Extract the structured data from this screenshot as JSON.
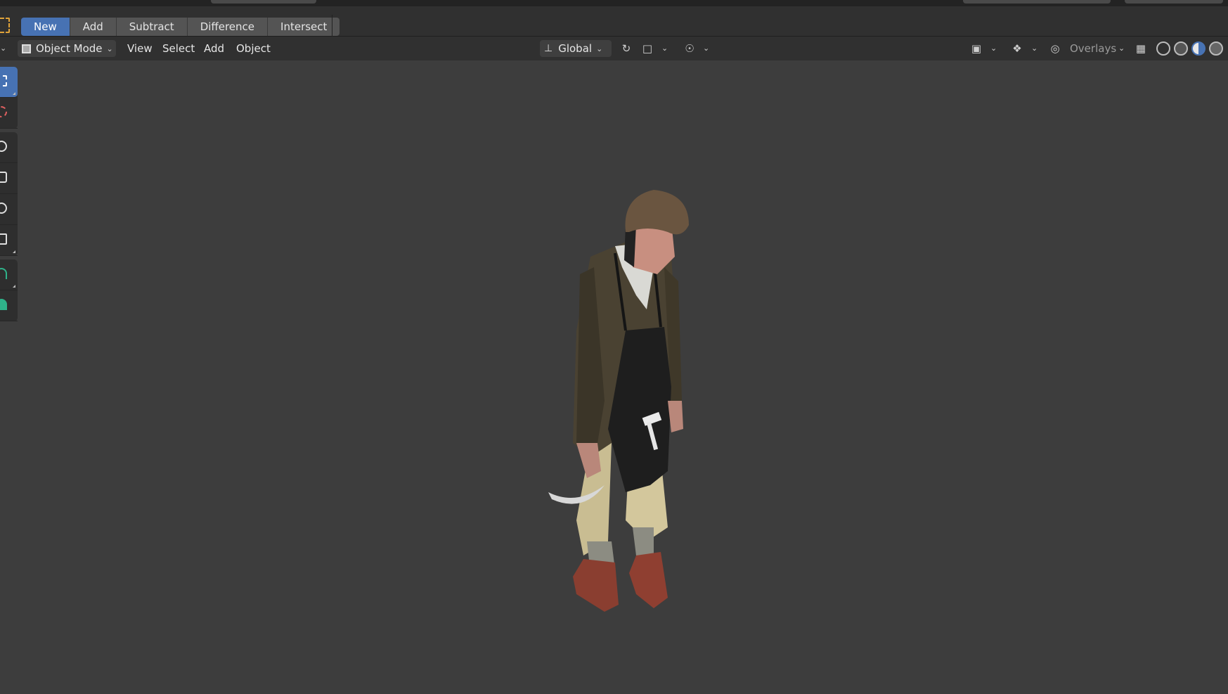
{
  "tool_header": {
    "buttons": [
      {
        "label": "New",
        "active": true
      },
      {
        "label": "Add",
        "active": false
      },
      {
        "label": "Subtract",
        "active": false
      },
      {
        "label": "Difference",
        "active": false
      },
      {
        "label": "Intersect",
        "active": false
      }
    ]
  },
  "view_header": {
    "mode": "Object Mode",
    "menus": [
      "View",
      "Select",
      "Add",
      "Object"
    ],
    "orientation": "Global",
    "overlays_label": "Overlays"
  },
  "toolbar": {
    "tools": [
      "select-box",
      "cursor",
      "move",
      "rotate",
      "scale",
      "transform",
      "annotate",
      "measure"
    ],
    "active_tool": "select-box"
  },
  "colors": {
    "accent": "#4772b3",
    "viewport_bg": "#3d3d3d",
    "header_bg": "#303030"
  }
}
